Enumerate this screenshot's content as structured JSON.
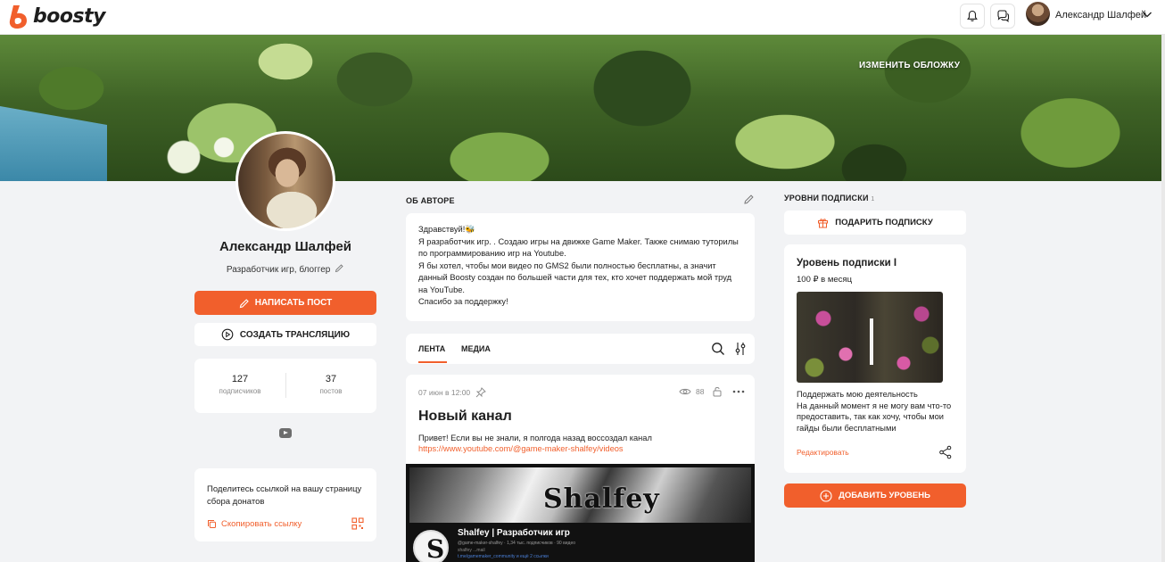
{
  "header": {
    "logo_text": "boosty",
    "user_name": "Александр Шалфей",
    "icons": [
      "bell-icon",
      "chat-icon",
      "chevron-down-icon"
    ]
  },
  "cover": {
    "change_cover_label": "ИЗМЕНИТЬ ОБЛОЖКУ"
  },
  "profile": {
    "name": "Александр Шалфей",
    "role": "Разработчик игр, блоггер",
    "write_post_label": "НАПИСАТЬ ПОСТ",
    "create_stream_label": "СОЗДАТЬ ТРАНСЛЯЦИЮ",
    "stats": [
      {
        "value": "127",
        "label": "подписчиков"
      },
      {
        "value": "37",
        "label": "постов"
      }
    ],
    "share": {
      "text": "Поделитесь ссылкой на вашу страницу сбора донатов",
      "copy_label": "Скопировать ссылку"
    }
  },
  "about": {
    "title": "ОБ АВТОРЕ",
    "lines": [
      "Здравствуй!🐝",
      "Я разработчик игр. . Создаю игры на движке Game Maker. Также снимаю туторилы по программированию игр на Youtube.",
      "Я бы хотел, чтобы мои видео по GMS2 были полностью бесплатны, а значит данный Boosty создан по большей части для тех, кто хочет поддержать мой труд на YouTube.",
      "Спасибо за поддержку!"
    ]
  },
  "feed": {
    "tabs": [
      {
        "label": "ЛЕНТА",
        "active": true
      },
      {
        "label": "МЕДИА",
        "active": false
      }
    ],
    "post": {
      "date": "07 июн в 12:00",
      "views": "88",
      "title": "Новый канал",
      "text": "Привет! Если вы не знали, я полгода назад воссоздал канал",
      "link": "https://www.youtube.com/@game-maker-shalfey/videos",
      "image": {
        "brand": "Shalfey",
        "avatar_letter": "S",
        "channel_name": "Shalfey | Разработчик игр",
        "channel_meta": "@game-maker-shalfey · 1,34 тыс. подписчиков · 90 видео",
        "channel_desc": "shalfey ...mail",
        "channel_link": "t.me/gamemaker_community и ещё 2 ссылки"
      }
    }
  },
  "levels": {
    "title": "УРОВНИ ПОДПИСКИ",
    "count": "1",
    "gift_label": "ПОДАРИТЬ ПОДПИСКУ",
    "card": {
      "title": "Уровень подписки I",
      "price": "100 ₽ в месяц",
      "desc_lines": [
        "Поддержать мою деятельность",
        "На данный момент я не могу вам что-то предоставить, так как хочу, чтобы мои гайды были бесплатными"
      ],
      "edit_label": "Редактировать"
    },
    "add_label": "ДОБАВИТЬ УРОВЕНЬ"
  },
  "colors": {
    "accent": "#f15f2c",
    "background": "#f2f3f5",
    "card": "#ffffff"
  }
}
